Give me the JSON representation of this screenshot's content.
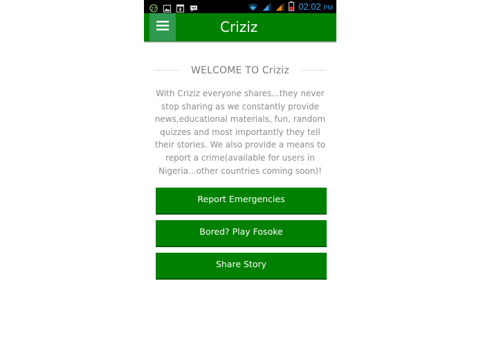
{
  "status_bar": {
    "notification_count": "27",
    "time": "02:02",
    "ampm": "PM",
    "time_color": "#3aa0e8",
    "icons": [
      "badge-27-icon",
      "gallery-icon",
      "calendar-icon",
      "chat-icon",
      "wifi-icon",
      "signal-icon",
      "signal-icon",
      "battery-icon"
    ]
  },
  "app_bar": {
    "title": "Criziz",
    "menu_icon": "hamburger-menu-icon",
    "color": "#008000"
  },
  "main": {
    "welcome_heading": "WELCOME TO Criziz",
    "intro_text": "With Criziz everyone shares...they never stop sharing as we constantly provide news,educational materials, fun, random quizzes and most importantly they tell their stories. We also provide a means to report a crime(available for users in Nigeria...other countries coming soon)!",
    "buttons": [
      {
        "label": "Report Emergencies"
      },
      {
        "label": "Bored? Play Fosoke"
      },
      {
        "label": "Share Story"
      }
    ]
  }
}
